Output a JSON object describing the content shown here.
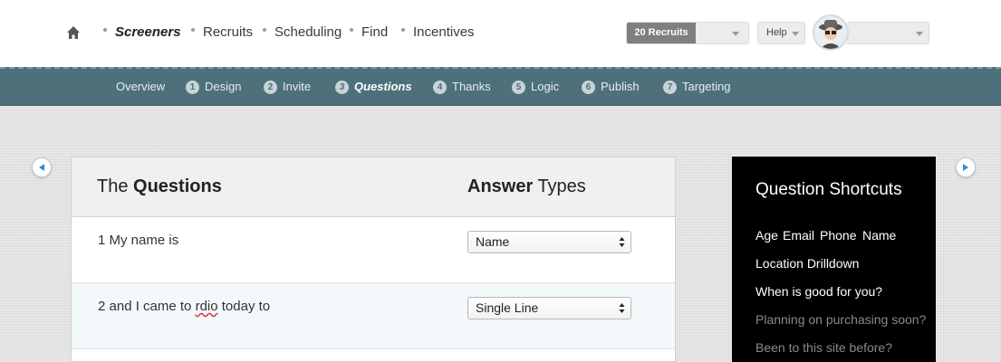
{
  "topnav": {
    "items": [
      {
        "label": "Screeners",
        "active": true
      },
      {
        "label": "Recruits",
        "active": false
      },
      {
        "label": "Scheduling",
        "active": false
      },
      {
        "label": "Find",
        "active": false
      },
      {
        "label": "Incentives",
        "active": false
      }
    ],
    "recruits_button": "20 Recruits",
    "help_label": "Help"
  },
  "steps": [
    {
      "label": "Overview"
    },
    {
      "num": "1",
      "label": "Design"
    },
    {
      "num": "2",
      "label": "Invite"
    },
    {
      "num": "3",
      "label": "Questions",
      "active": true
    },
    {
      "num": "4",
      "label": "Thanks"
    },
    {
      "num": "5",
      "label": "Logic"
    },
    {
      "num": "6",
      "label": "Publish"
    },
    {
      "num": "7",
      "label": "Targeting"
    }
  ],
  "questions_panel": {
    "header_left_prefix": "The ",
    "header_left_bold": "Questions",
    "header_right_bold": "Answer",
    "header_right_suffix": " Types",
    "rows": [
      {
        "num": "1",
        "text_before": "My name is",
        "text_misspelled": "",
        "text_after": "",
        "answer_type": "Name"
      },
      {
        "num": "2",
        "text_before": "and I came to ",
        "text_misspelled": "rdio",
        "text_after": " today to",
        "answer_type": "Single Line"
      }
    ]
  },
  "shortcuts": {
    "title": "Question Shortcuts",
    "items": [
      {
        "label": "Age",
        "enabled": true
      },
      {
        "label": "Email",
        "enabled": true
      },
      {
        "label": "Phone",
        "enabled": true
      },
      {
        "label": "Name",
        "enabled": true
      },
      {
        "label": "Location Drilldown",
        "enabled": true
      },
      {
        "label": "When is good for you?",
        "enabled": true
      },
      {
        "label": "Planning on purchasing soon?",
        "enabled": false
      },
      {
        "label": "Been to this site before?",
        "enabled": false
      }
    ]
  },
  "colors": {
    "step_bar": "#4e707b",
    "shortcuts_bg": "#000000",
    "recruits_button": "#7f7f7f",
    "arrow_blue": "#2a8fd6"
  },
  "icons": [
    "home-icon",
    "chevron-down-icon",
    "avatar",
    "arrow-left-icon",
    "arrow-right-icon",
    "select-updown-icon"
  ]
}
